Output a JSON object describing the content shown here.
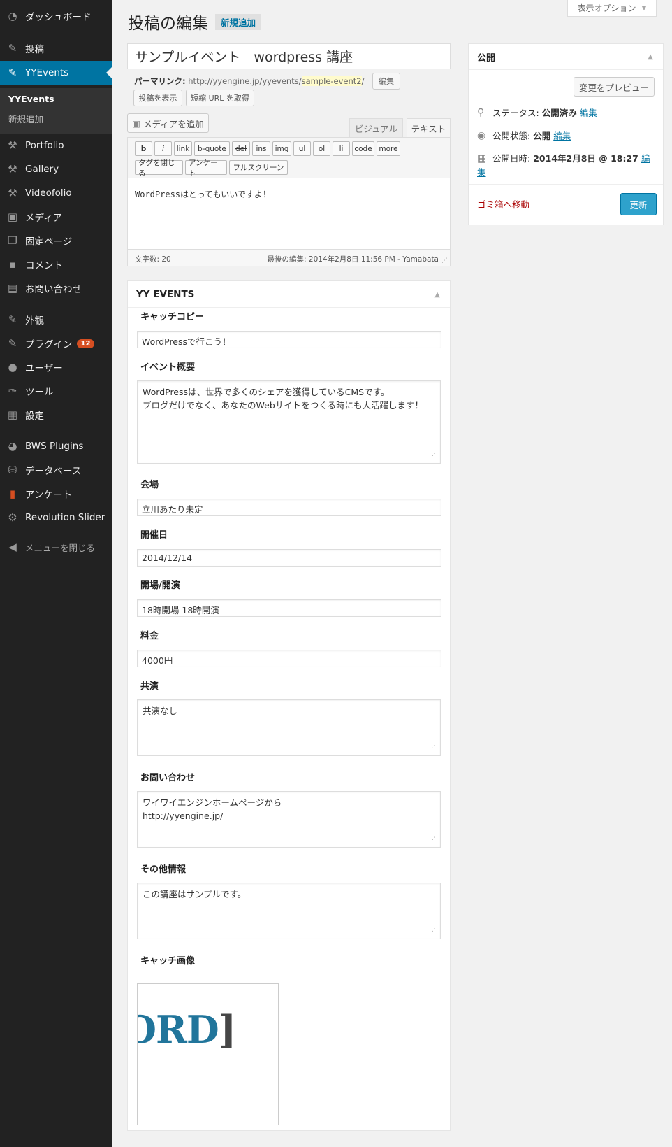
{
  "sidebar": {
    "items": [
      {
        "label": "ダッシュボード",
        "icon": "dashboard-icon"
      },
      {
        "label": "投稿",
        "icon": "pin-icon"
      },
      {
        "label": "YYEvents",
        "icon": "pin-icon"
      },
      {
        "label": "Portfolio",
        "icon": "portfolio-icon"
      },
      {
        "label": "Gallery",
        "icon": "gallery-icon"
      },
      {
        "label": "Videofolio",
        "icon": "video-icon"
      },
      {
        "label": "メディア",
        "icon": "media-icon"
      },
      {
        "label": "固定ページ",
        "icon": "page-icon"
      },
      {
        "label": "コメント",
        "icon": "comment-icon"
      },
      {
        "label": "お問い合わせ",
        "icon": "contact-icon"
      },
      {
        "label": "外観",
        "icon": "appearance-icon"
      },
      {
        "label": "プラグイン",
        "icon": "plugin-icon",
        "badge": "12"
      },
      {
        "label": "ユーザー",
        "icon": "user-icon"
      },
      {
        "label": "ツール",
        "icon": "wrench-icon"
      },
      {
        "label": "設定",
        "icon": "settings-icon"
      },
      {
        "label": "BWS Plugins",
        "icon": "bws-icon"
      },
      {
        "label": "データベース",
        "icon": "database-icon"
      },
      {
        "label": "アンケート",
        "icon": "poll-icon"
      },
      {
        "label": "Revolution Slider",
        "icon": "gear-icon"
      }
    ],
    "submenu": [
      "YYEvents",
      "新規追加"
    ],
    "collapse": "メニューを閉じる"
  },
  "header": {
    "screen_options": "表示オプション",
    "title": "投稿の編集",
    "add_new": "新規追加"
  },
  "post": {
    "title": "サンプルイベント　wordpress 講座",
    "permalink_label": "パーマリンク:",
    "permalink_base": "http://yyengine.jp/yyevents/",
    "permalink_slug": "sample-event2",
    "permalink_end": "/",
    "edit_btn": "編集",
    "view_btn": "投稿を表示",
    "shortlink_btn": "短縮 URL を取得"
  },
  "editor": {
    "add_media": "メディアを追加",
    "tab_visual": "ビジュアル",
    "tab_text": "テキスト",
    "quicktags": [
      "b",
      "i",
      "link",
      "b-quote",
      "del",
      "ins",
      "img",
      "ul",
      "ol",
      "li",
      "code",
      "more"
    ],
    "quicktags2": [
      "タグを閉じる",
      "アンケート",
      "フルスクリーン"
    ],
    "content": "WordPressはとってもいいですよ！",
    "word_count": "文字数: 20",
    "last_edited": "最後の編集: 2014年2月8日 11:56 PM - Yamabata"
  },
  "yy": {
    "title": "YY EVENTS",
    "fields": [
      {
        "label": "キャッチコピー",
        "value": "WordPressで行こう！"
      },
      {
        "label": "イベント概要",
        "lines": [
          "WordPressは、世界で多くのシェアを獲得しているCMSです。",
          "ブログだけでなく、あなたのWebサイトをつくる時にも大活躍します！"
        ]
      },
      {
        "label": "会場",
        "value": "立川あたり未定"
      },
      {
        "label": "開催日",
        "value": "2014/12/14"
      },
      {
        "label": "開場/開演",
        "value": "18時開場  18時開演"
      },
      {
        "label": "料金",
        "value": "4000円"
      },
      {
        "label": "共演",
        "lines": [
          "共演なし"
        ]
      },
      {
        "label": "お問い合わせ",
        "lines": [
          "ワイワイエンジンホームページから",
          "http://yyengine.jp/"
        ]
      },
      {
        "label": "その他情報",
        "lines": [
          "この講座はサンプルです。"
        ]
      },
      {
        "label": "キャッチ画像"
      }
    ],
    "logo_text_blue": "ORD",
    "logo_text_dark": "]"
  },
  "publish": {
    "title": "公開",
    "preview": "変更をプレビュー",
    "status_label": "ステータス:",
    "status_value": "公開済み",
    "visibility_label": "公開状態:",
    "visibility_value": "公開",
    "date_label": "公開日時:",
    "date_value": "2014年2月8日 @ 18:27",
    "edit": "編集",
    "edit_part1": "編",
    "edit_part2": "集",
    "trash": "ゴミ箱へ移動",
    "update": "更新"
  },
  "colors": {
    "sidebar": "#222222",
    "active": "#0074a2",
    "button_primary": "#2ea2cc",
    "badge": "#d54e21",
    "trash": "#aa0000"
  }
}
